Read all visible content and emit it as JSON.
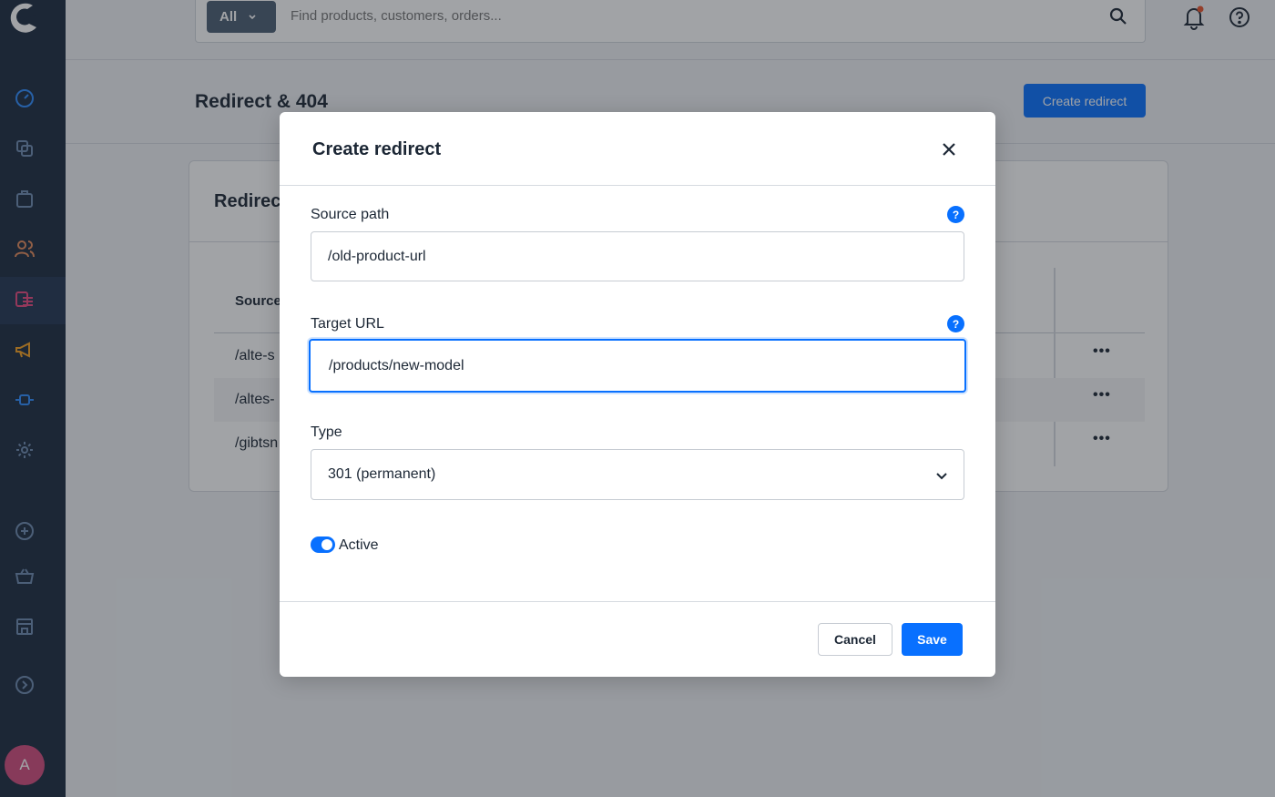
{
  "topbar": {
    "scope_label": "All",
    "search_placeholder": "Find products, customers, orders..."
  },
  "page": {
    "title": "Redirect & 404",
    "create_button": "Create redirect"
  },
  "card": {
    "title": "Redirec",
    "column_source": "Source",
    "rows": [
      {
        "source": "/alte-s",
        "actions": "•••"
      },
      {
        "source": "/altes-",
        "actions": "•••"
      },
      {
        "source": "/gibtsn",
        "actions": "•••"
      }
    ]
  },
  "sidebar": {
    "avatar_initial": "A",
    "items": [
      "dashboard-icon",
      "catalogues-icon",
      "orders-icon",
      "customers-icon",
      "content-icon",
      "marketing-icon",
      "extensions-icon",
      "settings-icon",
      "add-icon",
      "basket-icon",
      "store-icon",
      "expand-icon"
    ],
    "accent_color": "#0870ff"
  },
  "modal": {
    "title": "Create redirect",
    "source_label": "Source path",
    "source_value": "/old-product-url",
    "target_label": "Target URL",
    "target_value": "/products/new-model",
    "help_glyph": "?",
    "type_label": "Type",
    "type_value": "301 (permanent)",
    "active_label": "Active",
    "active_on": true,
    "cancel_label": "Cancel",
    "save_label": "Save"
  }
}
